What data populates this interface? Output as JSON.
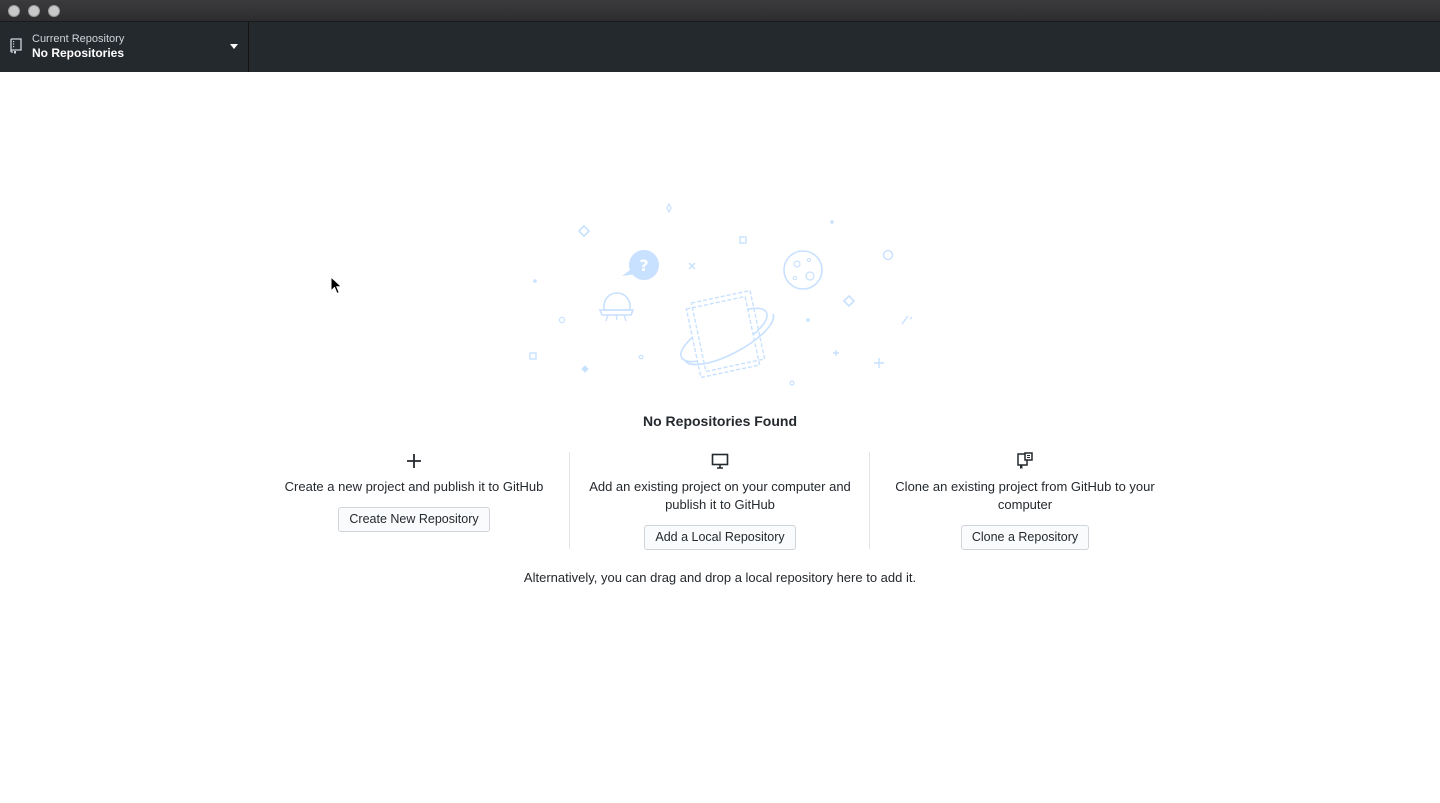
{
  "window": {
    "traffic_lights": [
      "close",
      "minimize",
      "zoom"
    ]
  },
  "toolbar": {
    "repository_selector": {
      "label": "Current Repository",
      "value": "No Repositories",
      "icon": "repo-icon"
    }
  },
  "main": {
    "heading": "No Repositories Found",
    "options": [
      {
        "icon": "plus-icon",
        "description": "Create a new project and publish it to GitHub",
        "button_label": "Create New Repository"
      },
      {
        "icon": "desktop-icon",
        "description": "Add an existing project on your computer and publish it to GitHub",
        "button_label": "Add a Local Repository"
      },
      {
        "icon": "repo-clone-icon",
        "description": "Clone an existing project from GitHub to your computer",
        "button_label": "Clone a Repository"
      }
    ],
    "footer": "Alternatively, you can drag and drop a local repository here to add it."
  },
  "colors": {
    "toolbar_bg": "#24292e",
    "illustration": "#c8e1ff",
    "text": "#24292e"
  }
}
